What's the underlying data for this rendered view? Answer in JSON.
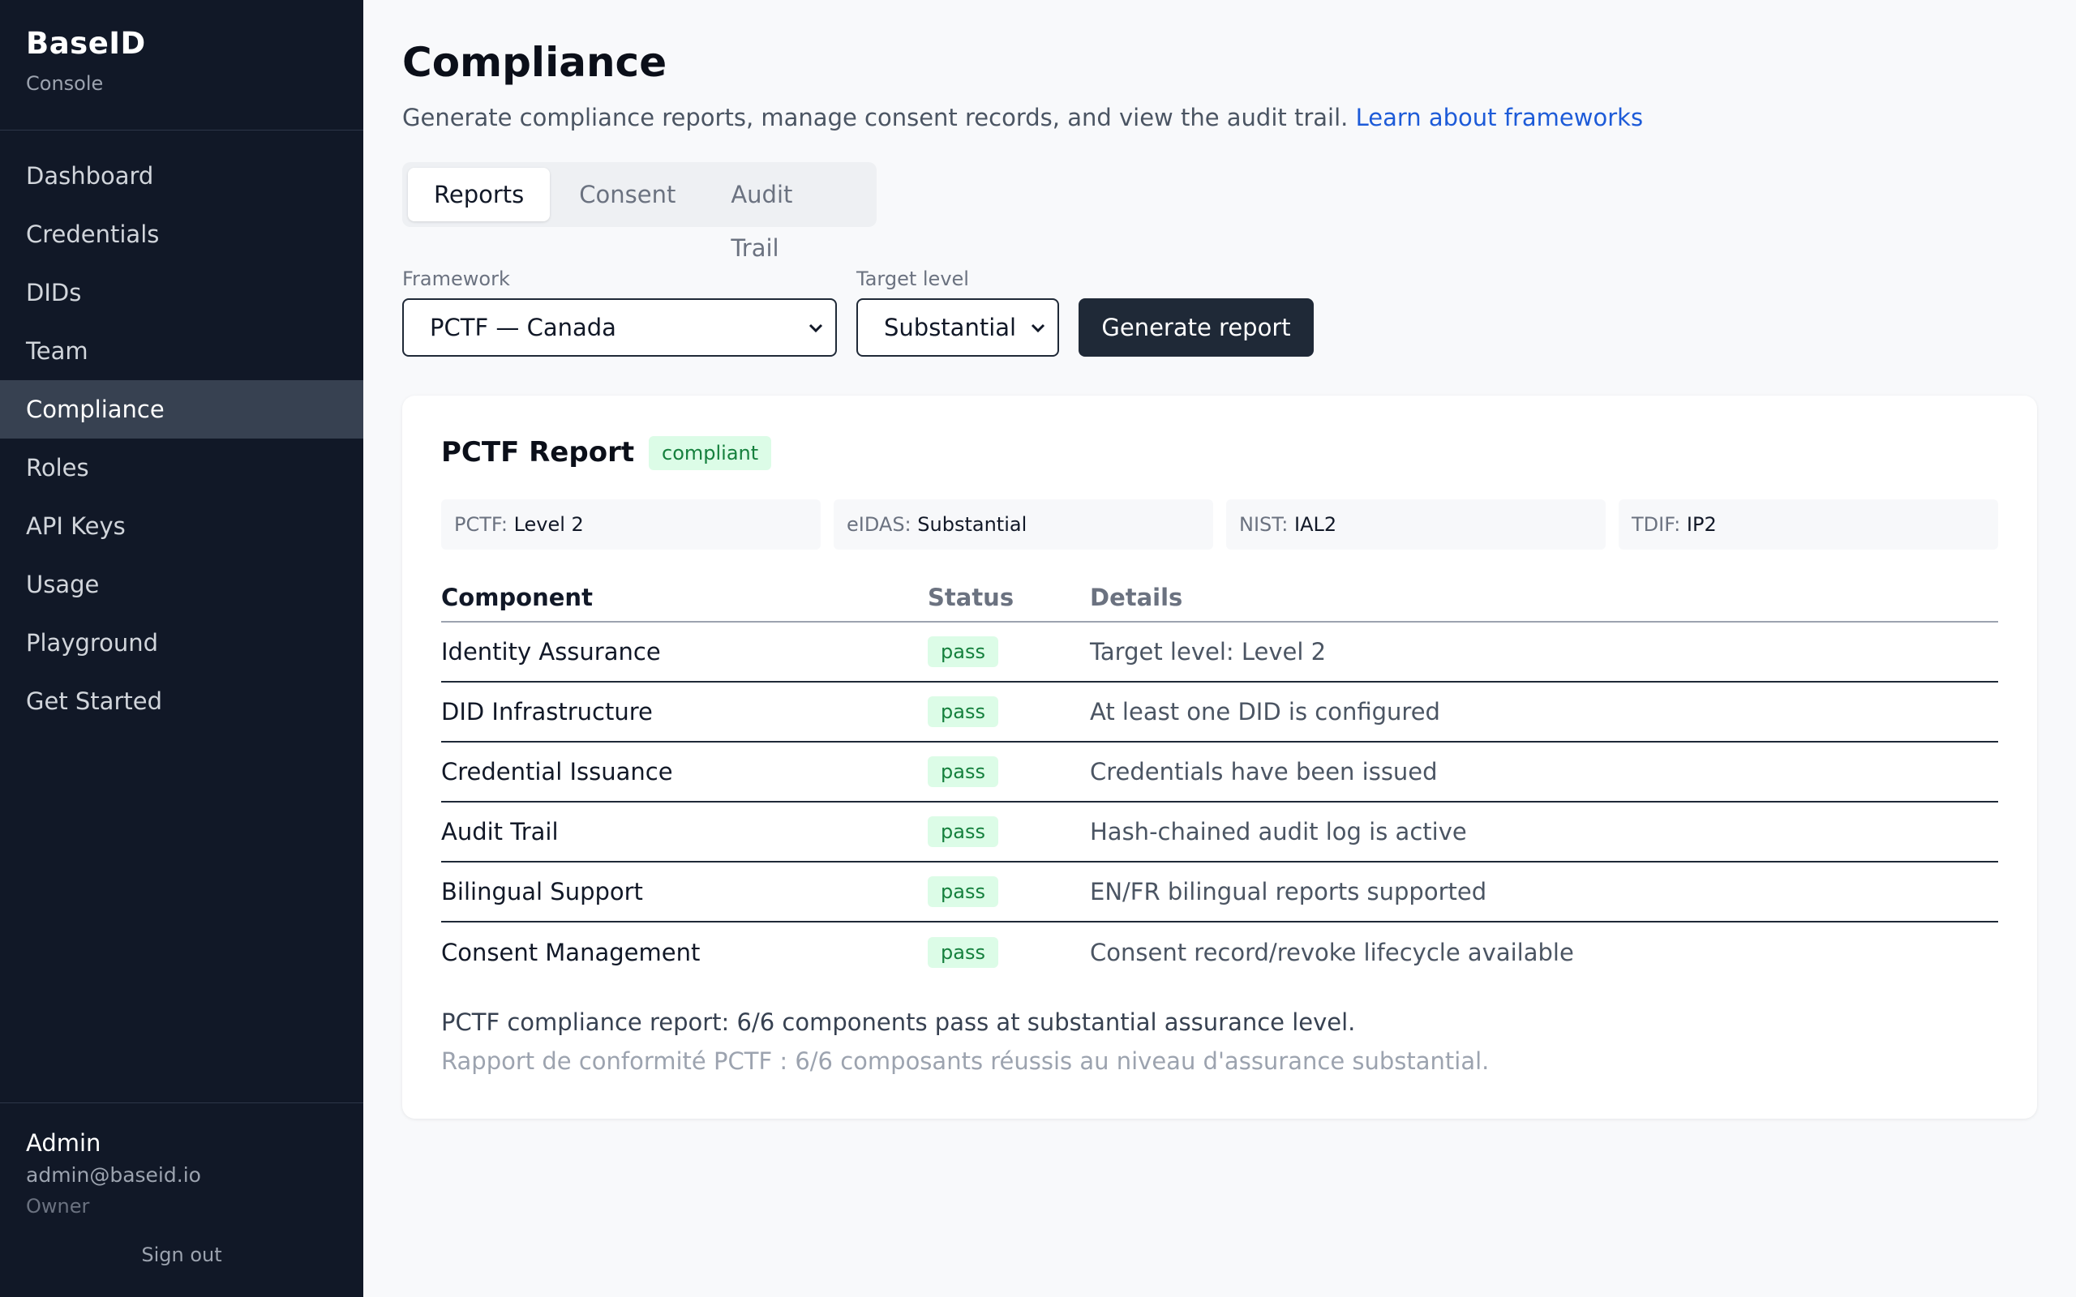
{
  "brand": {
    "name": "BaseID",
    "subtitle": "Console"
  },
  "nav": [
    {
      "label": "Dashboard"
    },
    {
      "label": "Credentials"
    },
    {
      "label": "DIDs"
    },
    {
      "label": "Team"
    },
    {
      "label": "Compliance",
      "active": true
    },
    {
      "label": "Roles"
    },
    {
      "label": "API Keys"
    },
    {
      "label": "Usage"
    },
    {
      "label": "Playground"
    },
    {
      "label": "Get Started"
    }
  ],
  "user": {
    "name": "Admin",
    "email": "admin@baseid.io",
    "role": "Owner",
    "signout": "Sign out"
  },
  "page": {
    "title": "Compliance",
    "description": "Generate compliance reports, manage consent records, and view the audit trail.",
    "link": "Learn about frameworks"
  },
  "tabs": [
    {
      "label": "Reports",
      "active": true
    },
    {
      "label": "Consent"
    },
    {
      "label": "Audit Trail"
    }
  ],
  "form": {
    "framework_label": "Framework",
    "framework_value": "PCTF — Canada",
    "level_label": "Target level",
    "level_value": "Substantial",
    "generate_label": "Generate report"
  },
  "report": {
    "title": "PCTF Report",
    "status": "compliant",
    "levels": [
      {
        "key": "PCTF:",
        "value": "Level 2"
      },
      {
        "key": "eIDAS:",
        "value": "Substantial"
      },
      {
        "key": "NIST:",
        "value": "IAL2"
      },
      {
        "key": "TDIF:",
        "value": "IP2"
      }
    ],
    "columns": [
      "Component",
      "Status",
      "Details"
    ],
    "rows": [
      {
        "component": "Identity Assurance",
        "status": "pass",
        "details": "Target level: Level 2"
      },
      {
        "component": "DID Infrastructure",
        "status": "pass",
        "details": "At least one DID is configured"
      },
      {
        "component": "Credential Issuance",
        "status": "pass",
        "details": "Credentials have been issued"
      },
      {
        "component": "Audit Trail",
        "status": "pass",
        "details": "Hash-chained audit log is active"
      },
      {
        "component": "Bilingual Support",
        "status": "pass",
        "details": "EN/FR bilingual reports supported"
      },
      {
        "component": "Consent Management",
        "status": "pass",
        "details": "Consent record/revoke lifecycle available"
      }
    ],
    "summary_en": "PCTF compliance report: 6/6 components pass at substantial assurance level.",
    "summary_fr": "Rapport de conformité PCTF : 6/6 composants réussis au niveau d'assurance substantial."
  },
  "colors": {
    "sidebar": "#111827",
    "accent": "#1d5bd8",
    "pass_bg": "#dcfce7",
    "pass_fg": "#15803d"
  }
}
